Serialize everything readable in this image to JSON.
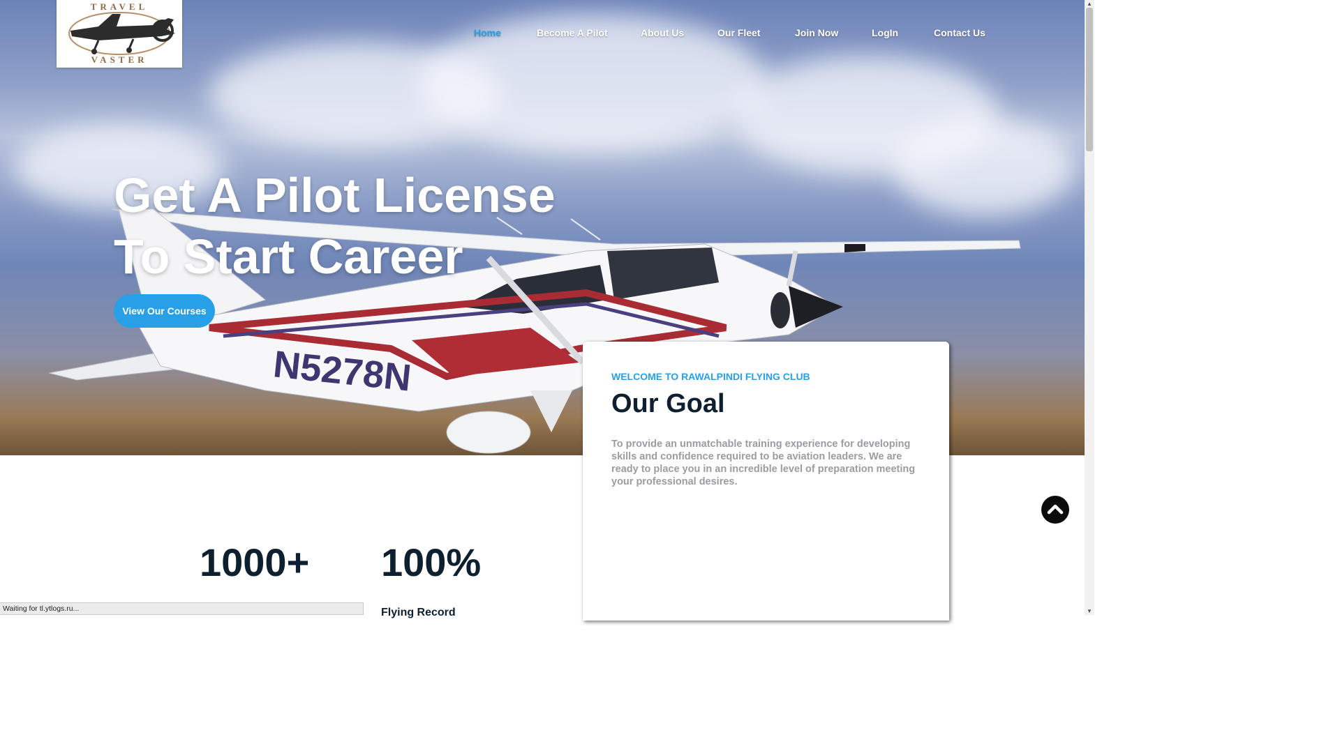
{
  "logo": {
    "top_text": "TRAVEL",
    "bottom_text": "VASTER"
  },
  "nav": {
    "items": [
      {
        "label": "Home",
        "active": true
      },
      {
        "label": "Become A Pilot"
      },
      {
        "label": "About Us"
      },
      {
        "label": "Our Fleet"
      },
      {
        "label": "Join Now"
      },
      {
        "label": "LogIn"
      },
      {
        "label": "Contact Us"
      }
    ]
  },
  "hero": {
    "headline_line1": "Get A Pilot License",
    "headline_line2": "To Start Career",
    "cta_label": "View Our Courses",
    "plane_registration": "N5278N"
  },
  "goal_card": {
    "eyebrow": "WELCOME TO RAWALPINDI FLYING CLUB",
    "title": "Our Goal",
    "text": "To provide an unmatchable training experience for developing skills and confidence required to be aviation leaders. We are ready to place you in an incredible level of preparation meeting your professional desires."
  },
  "stats": [
    {
      "value": "1000+"
    },
    {
      "value": "100%",
      "label": "Flying Record"
    }
  ],
  "status_bar": {
    "text": "Waiting for tl.ytlogs.ru..."
  },
  "colors": {
    "accent": "#27a0e8",
    "heading": "#0e2030",
    "body_text": "#999da3"
  },
  "icons": {
    "scroll_top": "chevron-up-icon"
  }
}
